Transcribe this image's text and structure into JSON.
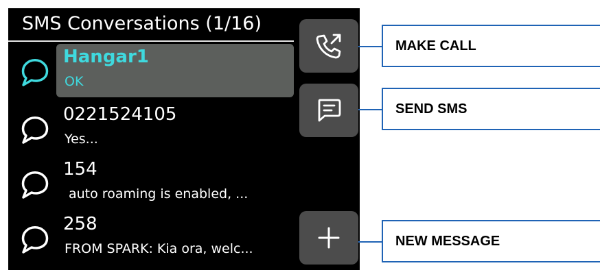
{
  "header": {
    "title": "SMS Conversations (1/16)"
  },
  "conversations": [
    {
      "name": "Hangar1",
      "preview": "OK",
      "selected": true
    },
    {
      "name": "0221524105",
      "preview": "Yes...",
      "selected": false
    },
    {
      "name": "154",
      "preview": "auto roaming is enabled, ...",
      "selected": false
    },
    {
      "name": "258",
      "preview": "FROM SPARK: Kia ora, welc...",
      "selected": false
    }
  ],
  "actions": {
    "make_call": {
      "icon": "phone-outgoing-icon"
    },
    "send_sms": {
      "icon": "message-icon"
    },
    "new_message": {
      "icon": "plus-icon"
    }
  },
  "callouts": {
    "make_call": "MAKE CALL",
    "send_sms": "SEND SMS",
    "new_message": "NEW MESSAGE"
  },
  "colors": {
    "accent": "#3fd9de",
    "selected_bg": "#5c5f5c",
    "button_bg": "#4c4c4c",
    "callout_border": "#1f63b5"
  }
}
